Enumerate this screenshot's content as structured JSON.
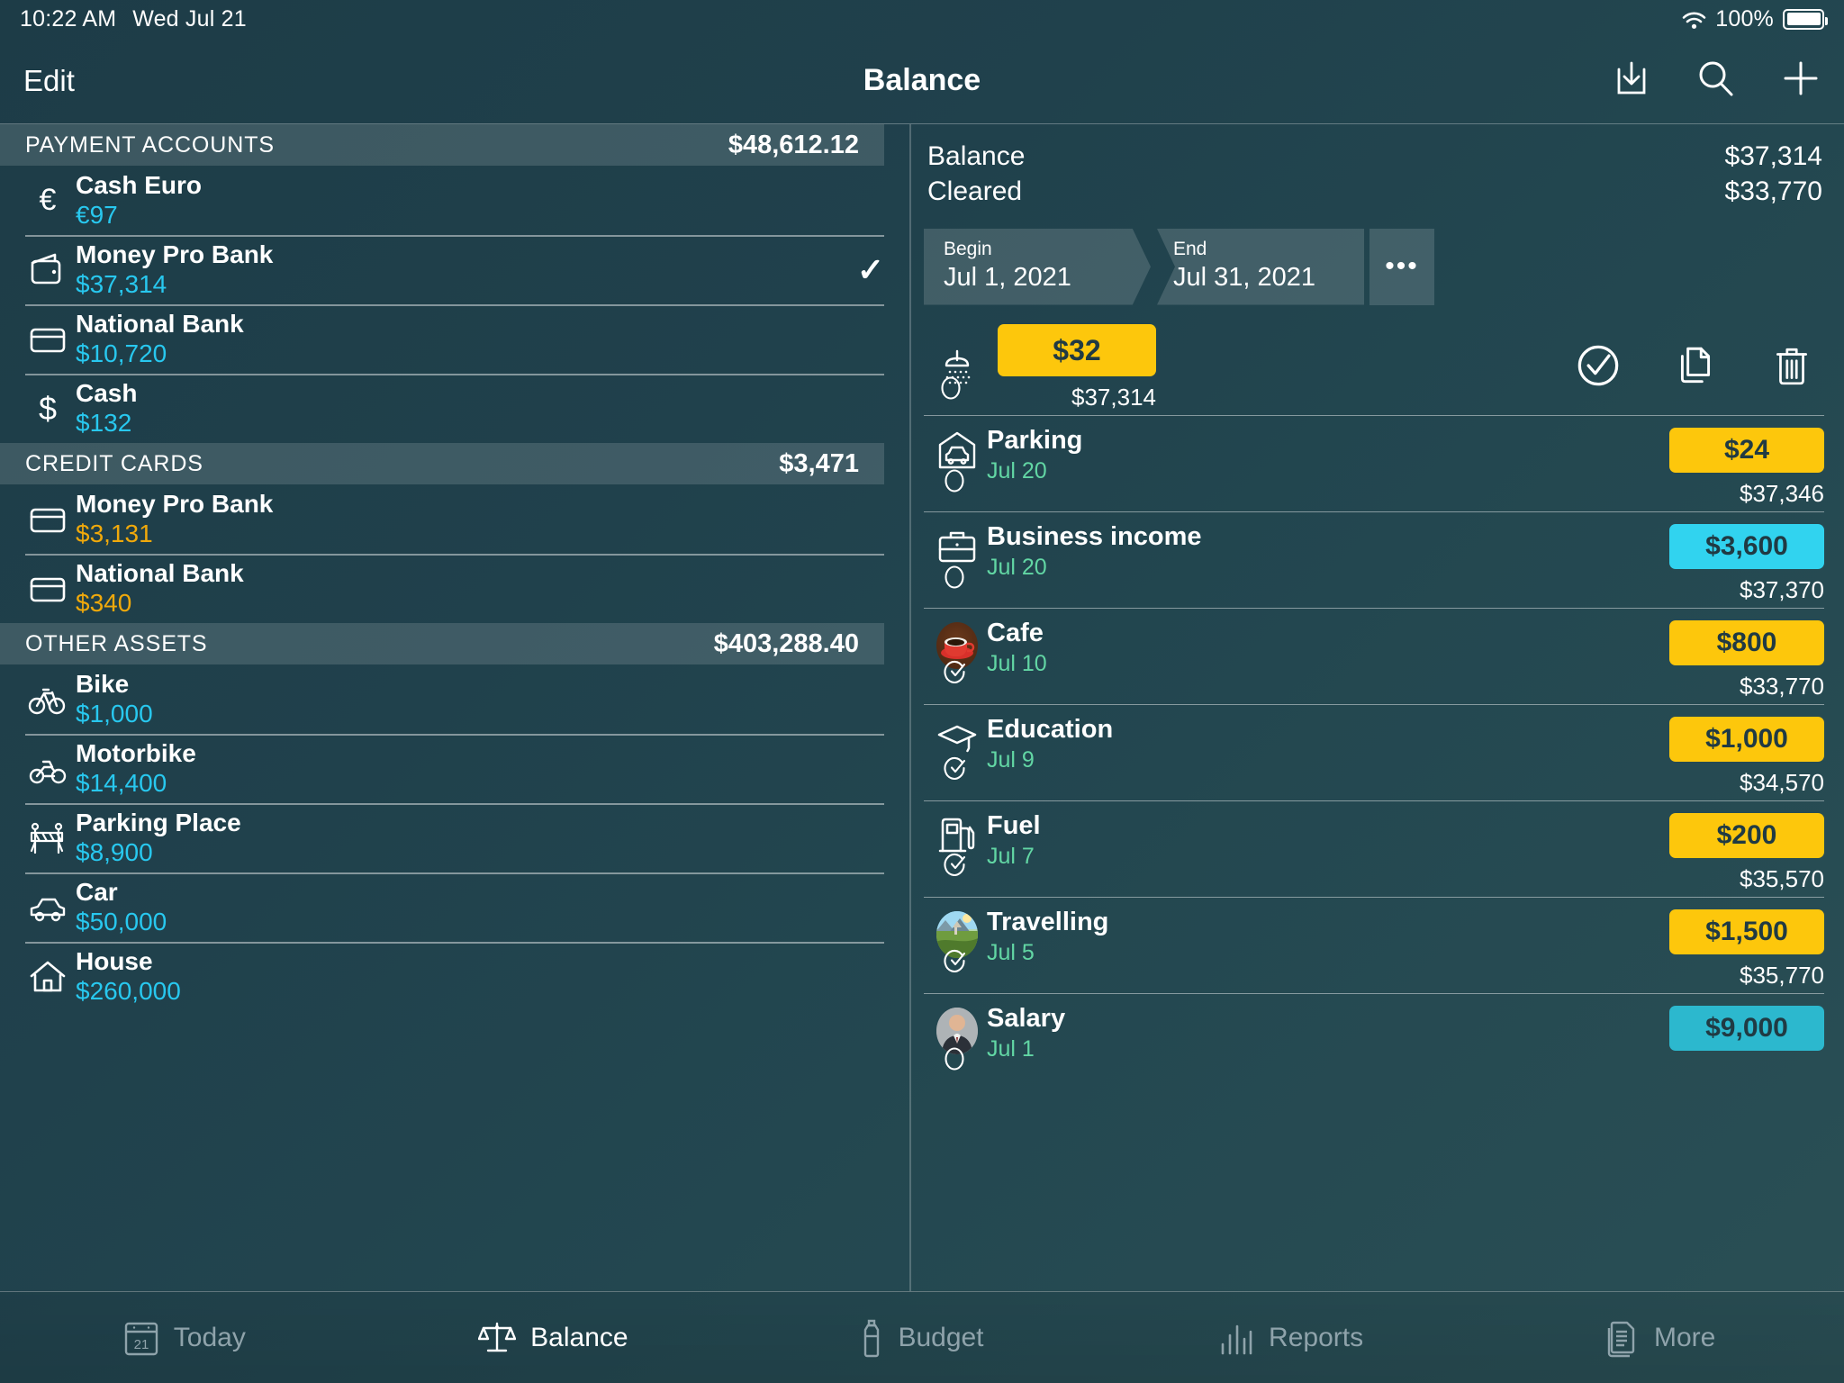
{
  "status": {
    "time": "10:22 AM",
    "date": "Wed Jul 21",
    "battery": "100%",
    "wifi_icon": "wifi-icon",
    "battery_icon": "battery-icon"
  },
  "nav": {
    "edit": "Edit",
    "title": "Balance",
    "export_icon": "export-icon",
    "search_icon": "search-icon",
    "add_icon": "plus-icon"
  },
  "accounts": {
    "sections": [
      {
        "title": "PAYMENT ACCOUNTS",
        "total": "$48,612.12",
        "items": [
          {
            "icon": "euro-icon",
            "name": "Cash Euro",
            "amount": "€97",
            "negative": false,
            "selected": false
          },
          {
            "icon": "wallet-icon",
            "name": "Money Pro Bank",
            "amount": "$37,314",
            "negative": false,
            "selected": true,
            "check": "✓"
          },
          {
            "icon": "credit-card-icon",
            "name": "National Bank",
            "amount": "$10,720",
            "negative": false,
            "selected": false
          },
          {
            "icon": "dollar-icon",
            "name": "Cash",
            "amount": "$132",
            "negative": false,
            "selected": false
          }
        ]
      },
      {
        "title": "CREDIT CARDS",
        "total": "$3,471",
        "items": [
          {
            "icon": "credit-card-icon",
            "name": "Money Pro Bank",
            "amount": "$3,131",
            "negative": true,
            "selected": false
          },
          {
            "icon": "credit-card-icon",
            "name": "National Bank",
            "amount": "$340",
            "negative": true,
            "selected": false
          }
        ]
      },
      {
        "title": "OTHER ASSETS",
        "total": "$403,288.40",
        "items": [
          {
            "icon": "bicycle-icon",
            "name": "Bike",
            "amount": "$1,000",
            "negative": false,
            "selected": false
          },
          {
            "icon": "motorbike-icon",
            "name": "Motorbike",
            "amount": "$14,400",
            "negative": false,
            "selected": false
          },
          {
            "icon": "barrier-icon",
            "name": "Parking Place",
            "amount": "$8,900",
            "negative": false,
            "selected": false
          },
          {
            "icon": "car-icon",
            "name": "Car",
            "amount": "$50,000",
            "negative": false,
            "selected": false
          },
          {
            "icon": "house-icon",
            "name": "House",
            "amount": "$260,000",
            "negative": false,
            "selected": false
          }
        ]
      }
    ]
  },
  "detail": {
    "balance_label": "Balance",
    "balance_value": "$37,314",
    "cleared_label": "Cleared",
    "cleared_value": "$33,770",
    "range": {
      "begin_label": "Begin",
      "begin_value": "Jul 1, 2021",
      "end_label": "End",
      "end_value": "Jul 31, 2021",
      "more_label": "•••",
      "more_icon": "ellipsis-icon"
    },
    "swiped_row": {
      "icon": "shower-icon",
      "amount": "$32",
      "running_balance": "$37,314",
      "cleared": false,
      "actions": [
        {
          "icon": "check-circle-icon",
          "name": "clear-transaction-action"
        },
        {
          "icon": "duplicate-icon",
          "name": "duplicate-transaction-action"
        },
        {
          "icon": "trash-icon",
          "name": "delete-transaction-action"
        }
      ]
    },
    "transactions": [
      {
        "icon": "parking-garage-icon",
        "title": "Parking",
        "date": "Jul 20",
        "amount": "$24",
        "kind": "exp",
        "running_balance": "$37,346",
        "cleared": false
      },
      {
        "icon": "briefcase-icon",
        "title": "Business income",
        "date": "Jul 20",
        "amount": "$3,600",
        "kind": "inc",
        "running_balance": "$37,370",
        "cleared": false
      },
      {
        "icon": "coffee-photo-icon",
        "title": "Cafe",
        "date": "Jul 10",
        "amount": "$800",
        "kind": "exp",
        "running_balance": "$33,770",
        "cleared": true
      },
      {
        "icon": "graduation-cap-icon",
        "title": "Education",
        "date": "Jul 9",
        "amount": "$1,000",
        "kind": "exp",
        "running_balance": "$34,570",
        "cleared": true
      },
      {
        "icon": "fuel-pump-icon",
        "title": "Fuel",
        "date": "Jul 7",
        "amount": "$200",
        "kind": "exp",
        "running_balance": "$35,570",
        "cleared": true
      },
      {
        "icon": "landscape-photo-icon",
        "title": "Travelling",
        "date": "Jul 5",
        "amount": "$1,500",
        "kind": "exp",
        "running_balance": "$35,770",
        "cleared": true
      },
      {
        "icon": "person-photo-icon",
        "title": "Salary",
        "date": "Jul 1",
        "amount": "$9,000",
        "kind": "inc2",
        "running_balance": "",
        "cleared": false
      }
    ]
  },
  "tabbar": {
    "tabs": [
      {
        "label": "Today",
        "icon": "calendar-21-icon",
        "active": false
      },
      {
        "label": "Balance",
        "icon": "scales-icon",
        "active": true
      },
      {
        "label": "Budget",
        "icon": "bottle-icon",
        "active": false
      },
      {
        "label": "Reports",
        "icon": "bar-chart-icon",
        "active": false
      },
      {
        "label": "More",
        "icon": "documents-icon",
        "active": false
      }
    ]
  },
  "colors": {
    "expense": "#fdc70c",
    "income": "#31d3ef",
    "amount_positive": "#28c8ef",
    "amount_negative": "#f0a90b",
    "date": "#62d6a4"
  }
}
